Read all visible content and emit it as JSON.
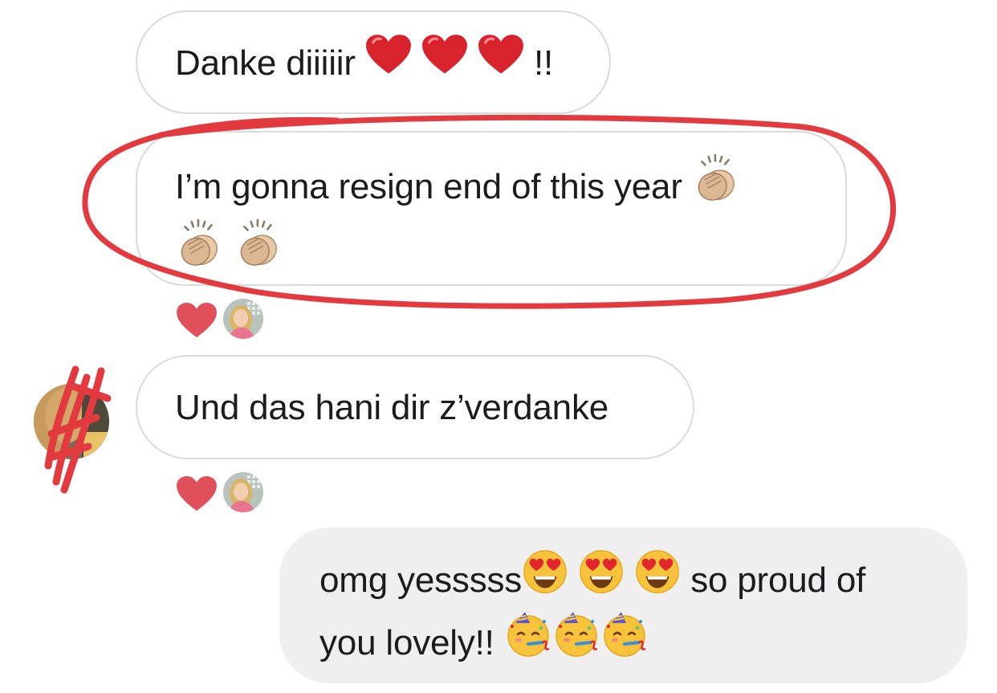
{
  "messages": [
    {
      "direction": "incoming",
      "text": "Danke diiiiir",
      "trailing_emoji": [
        "red-heart",
        "red-heart",
        "red-heart"
      ],
      "suffix": "!!"
    },
    {
      "direction": "incoming",
      "text": "I’m gonna resign end of this year",
      "trailing_emoji": [
        "clapping-hands",
        "clapping-hands",
        "clapping-hands"
      ],
      "reaction": "red-heart"
    },
    {
      "direction": "incoming",
      "text": "Und das hani dir z’verdanke",
      "reaction": "red-heart"
    },
    {
      "direction": "outgoing",
      "text_part1": "omg yesssss",
      "emoji_part1": [
        "heart-eyes",
        "heart-eyes",
        "heart-eyes"
      ],
      "text_part2": "so proud of",
      "text_part3": "you lovely!!",
      "emoji_part3": [
        "partying-face",
        "partying-face",
        "partying-face"
      ]
    }
  ],
  "colors": {
    "incoming_border": "#dadada",
    "outgoing_bg": "#efefef",
    "reaction_heart": "#e0505a",
    "annotation_red": "#e23a3f"
  }
}
